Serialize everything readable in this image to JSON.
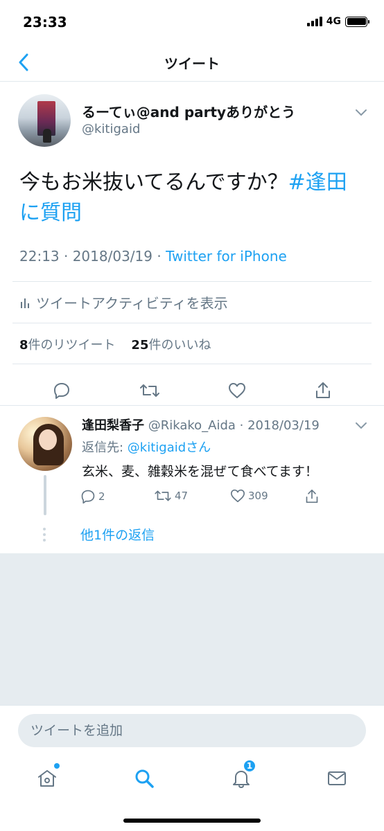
{
  "status_bar": {
    "time": "23:33",
    "network": "4G"
  },
  "nav": {
    "title": "ツイート"
  },
  "tweet": {
    "display_name": "るーてぃ@and partyありがとう",
    "handle": "@kitigaid",
    "text": "今もお米抜いてるんですか？",
    "hashtag": "#逢田に質問",
    "time": "22:13 · 2018/03/19 · ",
    "source": "Twitter for iPhone",
    "activity_label": "ツイートアクティビティを表示",
    "retweet_count": "8",
    "retweet_label": "件のリツイート",
    "like_count": "25",
    "like_label": "件のいいね"
  },
  "reply": {
    "display_name": "逢田梨香子",
    "handle_date": " @Rikako_Aida · 2018/03/19",
    "replying_to_prefix": "返信先: ",
    "replying_to_mention": "@kitigaidさん",
    "text": "玄米、麦、雑穀米を混ぜて食べてます！",
    "reply_count": "2",
    "retweet_count": "47",
    "like_count": "309",
    "more_replies": "他1件の返信"
  },
  "compose": {
    "placeholder": "ツイートを追加"
  },
  "tabbar": {
    "notifications_badge": "1"
  },
  "colors": {
    "accent": "#1da1f2",
    "secondary_text": "#657786",
    "divider": "#e1e8ed",
    "background_gray": "#e6ecf0"
  }
}
